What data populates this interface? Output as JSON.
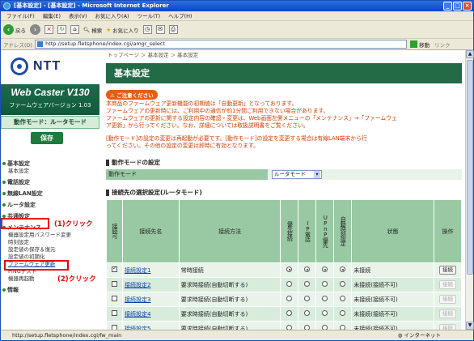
{
  "window": {
    "title": "[基本設定] - [基本設定] - Microsoft Internet Explorer"
  },
  "menu": [
    "ファイル(F)",
    "編集(E)",
    "表示(V)",
    "お気に入り(A)",
    "ツール(T)",
    "ヘルプ(H)"
  ],
  "toolbar": {
    "back": "戻る",
    "search": "検索",
    "favorites": "お気に入り"
  },
  "address": {
    "label": "アドレス(D)",
    "url": "http://setup.fletsphone/index.cgi/amgr_select",
    "go": "移動",
    "links": "リンク"
  },
  "status_bar": {
    "url": "http://setup.fletsphone/index.cgi/fw_main",
    "zone": "インターネット"
  },
  "sidebar": {
    "logo": "NTT",
    "product_name": "Web Caster V130",
    "product_version": "ファームウェアバージョン 1.03",
    "mode": "動作モード：ルータモード",
    "save": "保存",
    "nav": [
      {
        "label": "基本設定",
        "subs": [
          "基本設定"
        ]
      },
      {
        "label": "電話設定",
        "subs": []
      },
      {
        "label": "無線LAN設定",
        "subs": []
      },
      {
        "label": "ルータ設定",
        "subs": []
      },
      {
        "label": "共通設定",
        "subs": []
      },
      {
        "label": "メンテナンス",
        "subs": [
          "機器設定用パスワード変更",
          "時刻設定",
          "設定値の保存＆復元",
          "設定値の初期化",
          "ファームウェア更新",
          "PINGテスト",
          "機器再起動"
        ]
      },
      {
        "label": "情報",
        "subs": []
      }
    ],
    "annotation1": "(1)クリック",
    "annotation2": "(2)クリック"
  },
  "main": {
    "breadcrumb": "トップページ ＞ 基本設定 ＞ 基本設定",
    "title": "基本設定",
    "caution_label": "ご注意ください",
    "notice_lines": [
      "本商品のファームウェア更新機能の初期値は「自動更新」となっております。",
      "ファームウェアの更新時には、ご利用中の通信が約1分間ご利用できない場合があります。",
      "ファームウェアの更新に関する設定内容の確認・変更は、Web画面左側メニューの「メンテナンス」→「ファームウェ",
      "ア更新」から行ってください。なお、詳細については取扱説明書をご覧ください。"
    ],
    "notice2_lines": [
      "[動作モード]の設定の変更は再起動が必要です。[動作モード]の設定を変更する場合は有線LAN端末から行",
      "ってください。その他の設定の変更は即時に有効となります。"
    ],
    "mode_section": {
      "heading": "動作モードの設定",
      "label": "動作モード",
      "value": "ルータモード"
    },
    "conn_section": {
      "heading": "接続先の選択設定(ルータモード)",
      "headers": {
        "enable": "接続可",
        "name": "接続先名",
        "method": "接続方法",
        "priority": "優先接続",
        "ip": "IP電話",
        "upnp": "UPnP優先",
        "auto": "自動時刻設定",
        "state": "状態",
        "op": "操作"
      },
      "rows": [
        {
          "enabled": true,
          "name": "接続設定1",
          "method": "常時接続",
          "priority": true,
          "ip": true,
          "upnp": true,
          "auto": true,
          "state": "未接続",
          "op": "接続",
          "op_disabled": false
        },
        {
          "enabled": false,
          "name": "接続設定2",
          "method": "要求時接続(自動切断する)",
          "priority": false,
          "ip": false,
          "upnp": false,
          "auto": false,
          "state": "未接続(接続不可)",
          "op": "接続",
          "op_disabled": true
        },
        {
          "enabled": false,
          "name": "接続設定3",
          "method": "要求時接続(自動切断する)",
          "priority": false,
          "ip": false,
          "upnp": false,
          "auto": false,
          "state": "未接続(接続不可)",
          "op": "接続",
          "op_disabled": true
        },
        {
          "enabled": false,
          "name": "接続設定4",
          "method": "要求時接続(自動切断する)",
          "priority": false,
          "ip": false,
          "upnp": false,
          "auto": false,
          "state": "未接続(接続不可)",
          "op": "接続",
          "op_disabled": true
        },
        {
          "enabled": false,
          "name": "接続設定5",
          "method": "要求時接続(自動切断する)",
          "priority": false,
          "ip": false,
          "upnp": false,
          "auto": false,
          "state": "未接続(接続不可)",
          "op": "接続",
          "op_disabled": true
        }
      ]
    }
  }
}
